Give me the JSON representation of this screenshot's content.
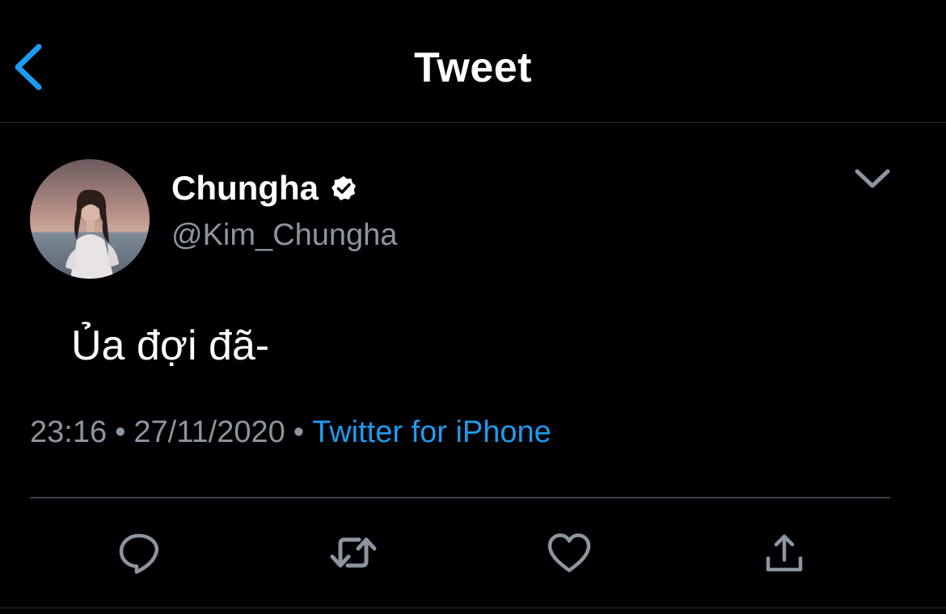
{
  "header": {
    "title": "Tweet",
    "back_icon": "chevron-left-icon"
  },
  "tweet": {
    "author": {
      "display_name": "Chungha",
      "handle": "@Kim_Chungha",
      "verified": true,
      "avatar_icon": "profile-photo"
    },
    "text": "Ủa đợi đã-",
    "time": "23:16",
    "date": "27/11/2020",
    "separator": "•",
    "source": "Twitter for iPhone",
    "more_icon": "chevron-down-icon"
  },
  "actions": [
    {
      "name": "reply",
      "icon": "reply-icon"
    },
    {
      "name": "retweet",
      "icon": "retweet-icon"
    },
    {
      "name": "like",
      "icon": "heart-icon"
    },
    {
      "name": "share",
      "icon": "share-icon"
    }
  ],
  "colors": {
    "background": "#000000",
    "accent": "#1d9bf0",
    "secondary_text": "#8b959e",
    "icon_gray": "#8b959e"
  }
}
